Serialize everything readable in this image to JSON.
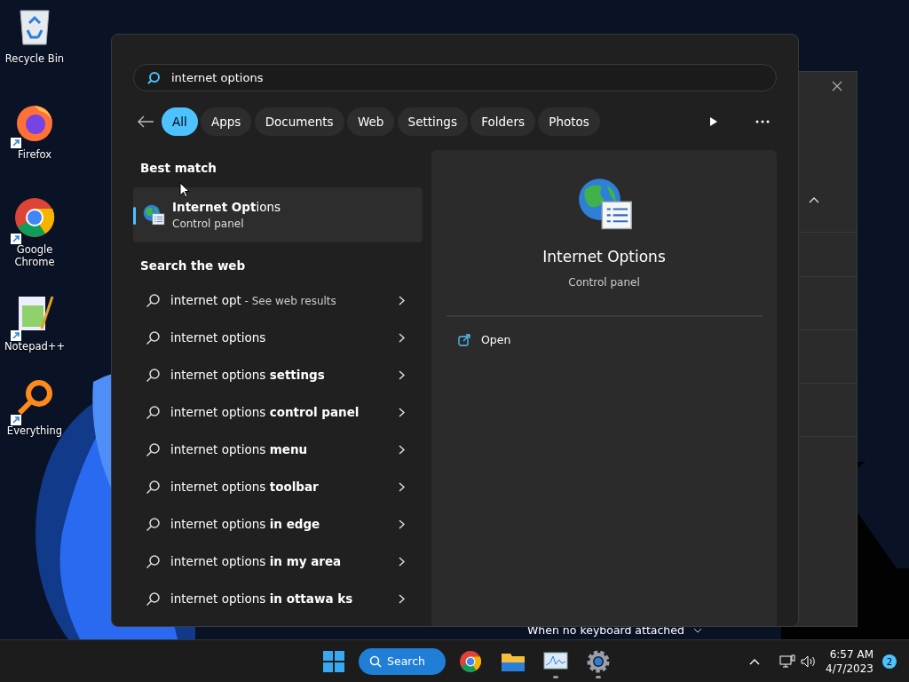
{
  "desktop_icons": [
    {
      "label": "Recycle Bin",
      "kind": "recycle",
      "shortcut": false
    },
    {
      "label": "Firefox",
      "kind": "firefox",
      "shortcut": true
    },
    {
      "label": "Google Chrome",
      "kind": "chrome",
      "shortcut": true
    },
    {
      "label": "Notepad++",
      "kind": "notepad",
      "shortcut": true
    },
    {
      "label": "Everything",
      "kind": "everything",
      "shortcut": true
    }
  ],
  "search": {
    "value": "internet options"
  },
  "filters": [
    {
      "label": "All",
      "selected": true
    },
    {
      "label": "Apps",
      "selected": false
    },
    {
      "label": "Documents",
      "selected": false
    },
    {
      "label": "Web",
      "selected": false
    },
    {
      "label": "Settings",
      "selected": false
    },
    {
      "label": "Folders",
      "selected": false
    },
    {
      "label": "Photos",
      "selected": false
    }
  ],
  "best_match": {
    "heading": "Best match",
    "title": "**Internet Opt**ions",
    "subtitle": "Control panel",
    "selected": true
  },
  "web": {
    "heading": "Search the web",
    "items": [
      {
        "text": "internet opt",
        "note": " - See web results"
      },
      {
        "text": "internet options"
      },
      {
        "text": "internet options **settings**"
      },
      {
        "text": "internet options **control panel**"
      },
      {
        "text": "internet options **menu**"
      },
      {
        "text": "internet options **toolbar**"
      },
      {
        "text": "internet options **in edge**"
      },
      {
        "text": "internet options **in my area**"
      },
      {
        "text": "internet options **in ottawa ks**"
      }
    ]
  },
  "preview": {
    "title": "Internet Options",
    "subtitle": "Control panel",
    "actions": [
      "Open"
    ]
  },
  "background_window": {
    "text": "When no keyboard attached"
  },
  "taskbar": {
    "search_label": "Search",
    "apps": [
      {
        "kind": "chrome",
        "running": false
      },
      {
        "kind": "folder",
        "running": false
      },
      {
        "kind": "monitor",
        "running": true
      },
      {
        "kind": "settings",
        "running": true
      }
    ],
    "time": "6:57 AM",
    "date": "4/7/2023",
    "notifications": "2"
  }
}
